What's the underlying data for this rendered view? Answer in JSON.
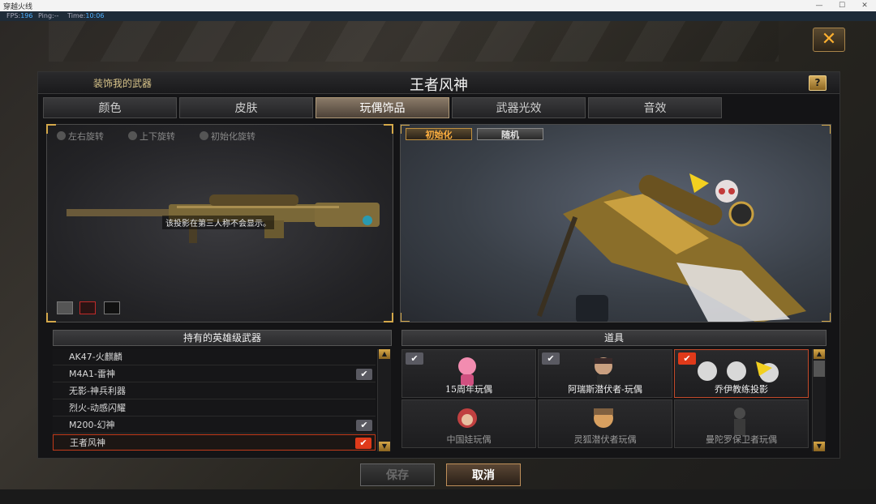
{
  "window": {
    "title": "穿越火线"
  },
  "stats": {
    "fps_label": "FPS:",
    "fps_value": "196",
    "ping_label": "Ping:--",
    "time_label": "Time:",
    "time_value": "10:06"
  },
  "dialog": {
    "subtitle": "装饰我的武器",
    "title": "王者风神",
    "help": "?",
    "close": "✕"
  },
  "tabs": [
    {
      "label": "颜色",
      "active": false
    },
    {
      "label": "皮肤",
      "active": false
    },
    {
      "label": "玩偶饰品",
      "active": true
    },
    {
      "label": "武器光效",
      "active": false
    },
    {
      "label": "音效",
      "active": false
    }
  ],
  "left_panel": {
    "rotations": [
      "左右旋转",
      "上下旋转",
      "初始化旋转"
    ],
    "tooltip": "该投影在第三人称不会显示。",
    "swatches": [
      "#555555",
      "#3a1a1a",
      "#111111"
    ]
  },
  "right_panel": {
    "init_button": "初始化",
    "random_button": "随机"
  },
  "weapons": {
    "header": "持有的英雄级武器",
    "items": [
      {
        "name": "AK47-火麒麟",
        "checked": false,
        "selected": false
      },
      {
        "name": "M4A1-雷神",
        "checked": true,
        "selected": false
      },
      {
        "name": "无影-神兵利器",
        "checked": false,
        "selected": false
      },
      {
        "name": "烈火-动感闪耀",
        "checked": false,
        "selected": false
      },
      {
        "name": "M200-幻神",
        "checked": true,
        "selected": false
      },
      {
        "name": "王者风神",
        "checked": true,
        "selected": true
      }
    ]
  },
  "props": {
    "header": "道具",
    "items": [
      {
        "name": "15周年玩偶",
        "checked": true,
        "selected": false,
        "dim": false,
        "color": "#f06aa0"
      },
      {
        "name": "阿瑞斯潜伏者-玩偶",
        "checked": true,
        "selected": false,
        "dim": false,
        "color": "#8a6a5a"
      },
      {
        "name": "乔伊教练投影",
        "checked": true,
        "selected": true,
        "dim": false,
        "color": "#d8d8d8"
      },
      {
        "name": "中国娃玩偶",
        "checked": false,
        "selected": false,
        "dim": true,
        "color": "#c04040"
      },
      {
        "name": "灵狐潜伏者玩偶",
        "checked": false,
        "selected": false,
        "dim": true,
        "color": "#d8a060"
      },
      {
        "name": "曼陀罗保卫者玩偶",
        "checked": false,
        "selected": false,
        "dim": true,
        "color": "#4a4a4a"
      }
    ]
  },
  "footer": {
    "save": "保存",
    "cancel": "取消"
  }
}
